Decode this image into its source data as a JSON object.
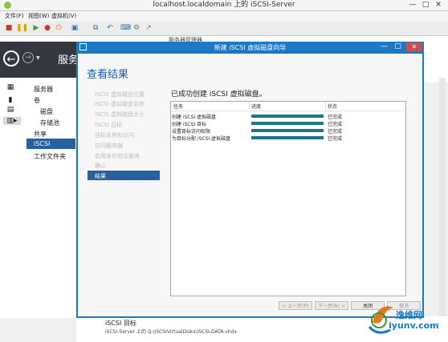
{
  "vm": {
    "title": "localhost.localdomain 上的 iSCSI-Server",
    "window_controls": [
      "—",
      "□",
      "✕"
    ],
    "menu": [
      "文件(F)",
      "视图(W)",
      "虚拟机(V)"
    ],
    "toolbar_icons": [
      "stop-icon",
      "pause-icon",
      "start-icon",
      "reset-icon",
      "shutdown-icon",
      "save-icon",
      "snapshot-icon",
      "revert-icon",
      "ctrl-alt-del-icon",
      "settings-icon",
      "share-icon"
    ]
  },
  "server_manager": {
    "title_partial": "服务器管理器",
    "header": "服务",
    "nav": {
      "items": [
        "服务器",
        "卷",
        "磁盘",
        "存储池",
        "共享",
        "iSCSI",
        "工作文件夹"
      ],
      "selected": "iSCSI"
    },
    "bottom": {
      "title": "iSCSI 目标",
      "path": "iSCSI-Server 上的 Q:\\iSCSIVirtualDisks\\iSCSI-DATA.vhdx"
    }
  },
  "wizard": {
    "title": "新建 iSCSI 虚拟磁盘向导",
    "heading": "查看结果",
    "steps": [
      "iSCSI 虚拟磁盘位置",
      "iSCSI 虚拟磁盘名称",
      "iSCSI 虚拟磁盘大小",
      "iSCSI 目标",
      "目标名称和访问",
      "访问服务器",
      "启用身份验证服务",
      "确认",
      "结果"
    ],
    "current_step": "结果",
    "success_message": "已成功创建 iSCSI 虚拟磁盘。",
    "table": {
      "columns": [
        "任务",
        "进度",
        "状态"
      ],
      "rows": [
        {
          "task": "创建 iSCSI 虚拟磁盘",
          "progress": 1.0,
          "status": "已完成"
        },
        {
          "task": "创建 iSCSI 目标",
          "progress": 1.0,
          "status": "已完成"
        },
        {
          "task": "设置目标访问权限",
          "progress": 1.0,
          "status": "已完成"
        },
        {
          "task": "为目标分配 iSCSI 虚拟磁盘",
          "progress": 1.0,
          "status": "已完成"
        }
      ]
    },
    "buttons": {
      "prev": "< 上一步(P)",
      "next": "下一步(N) >",
      "close": "关闭",
      "cancel": "取消"
    }
  },
  "watermark": {
    "site_name": "逸维网",
    "site_url": "iyunv.com"
  },
  "colors": {
    "accent": "#1c79c6",
    "selection": "#26609f",
    "progress": "#1e7680"
  }
}
